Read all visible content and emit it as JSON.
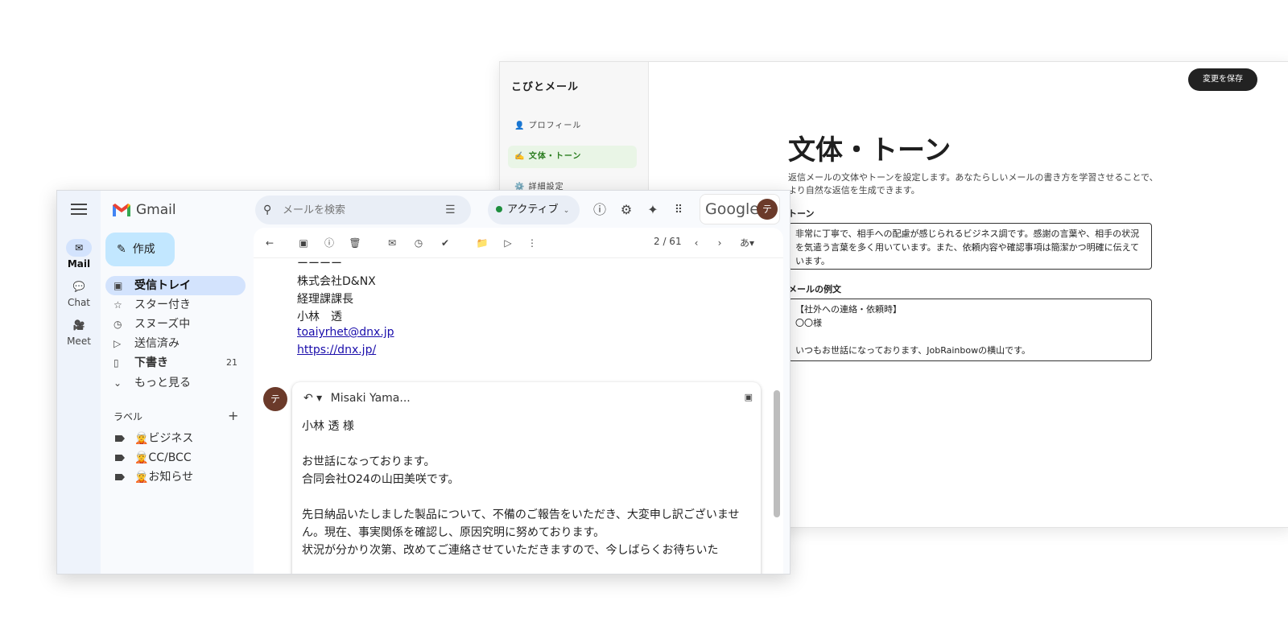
{
  "kobito": {
    "brand": "こびとメール",
    "nav": [
      {
        "label": "👤 プロフィール"
      },
      {
        "label": "✍️ 文体・トーン"
      },
      {
        "label": "⚙️ 詳細設定"
      }
    ],
    "save_label": "変更を保存",
    "title": "文体・トーン",
    "description": "返信メールの文体やトーンを設定します。あなたらしいメールの書き方を学習させることで、より自然な返信を生成できます。",
    "tone_label": "トーン",
    "tone_text": "非常に丁寧で、相手への配慮が感じられるビジネス調です。感謝の言葉や、相手の状況を気遣う言葉を多く用いています。また、依頼内容や確認事項は簡潔かつ明確に伝えています。",
    "example_label": "メールの例文",
    "example_text": "【社外への連絡・依頼時】\n〇〇様\n\nいつもお世話になっております、JobRainbowの横山です。"
  },
  "gmail": {
    "rail": [
      {
        "label": "Mail",
        "icon": "✉"
      },
      {
        "label": "Chat",
        "icon": "💬"
      },
      {
        "label": "Meet",
        "icon": "🎥"
      }
    ],
    "logo_text": "Gmail",
    "search_placeholder": "メールを検索",
    "status": "アクティブ",
    "google_text": "Google",
    "avatar_letter": "テ",
    "compose_label": "作成",
    "nav": [
      {
        "label": "受信トレイ",
        "icon": "▣",
        "count": ""
      },
      {
        "label": "スター付き",
        "icon": "☆",
        "count": ""
      },
      {
        "label": "スヌーズ中",
        "icon": "◷",
        "count": ""
      },
      {
        "label": "送信済み",
        "icon": "▷",
        "count": ""
      },
      {
        "label": "下書き",
        "icon": "▯",
        "count": "21"
      },
      {
        "label": "もっと見る",
        "icon": "⌄",
        "count": ""
      }
    ],
    "labels_heading": "ラベル",
    "labels": [
      {
        "label": "🧝ビジネス"
      },
      {
        "label": "🧝CC/BCC"
      },
      {
        "label": "🧝お知らせ"
      }
    ],
    "pager": "2 / 61",
    "signature": {
      "dash": "ーーーー",
      "company": "株式会社D&NX",
      "position": "経理課課長",
      "name": "小林　透",
      "email": "toaiyrhet@dnx.jp",
      "url": "https://dnx.jp/"
    },
    "reply": {
      "to": "Misaki Yama...",
      "body": "小林 透 様\n\nお世話になっております。\n合同会社O24の山田美咲です。\n\n先日納品いたしました製品について、不備のご報告をいただき、大変申し訳ございません。現在、事実関係を確認し、原因究明に努めております。\n状況が分かり次第、改めてご連絡させていただきますので、今しばらくお待ちいた"
    }
  }
}
